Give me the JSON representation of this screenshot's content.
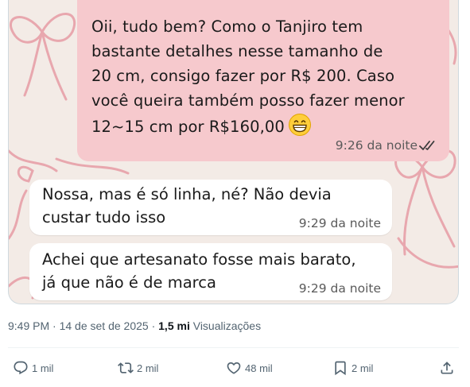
{
  "chat": {
    "outgoing": {
      "text": "Oii, tudo bem? Como o Tanjiro tem\nbastante detalhes nesse tamanho  de\n20 cm, consigo fazer por R$ 200. Caso\nvocê queira também posso fazer menor\n12~15 cm por R$160,00",
      "emoji": "grinning-face",
      "time": "9:26 da noite",
      "status": "read"
    },
    "incoming": [
      {
        "text": "Nossa, mas é só linha, né? Não devia\ncustar tudo isso",
        "time": "9:29 da noite"
      },
      {
        "text": "Achei que artesanato fosse mais barato,\njá que não é de marca",
        "time": "9:29 da noite"
      }
    ],
    "colors": {
      "outgoing_bubble": "#f6c9cd",
      "incoming_bubble": "#ffffff",
      "wallpaper": "#f3ebe6",
      "ribbon": "#e8a7ae"
    }
  },
  "tweet_meta": {
    "timestamp": "9:49 PM · 14 de set de 2025",
    "separator": " · ",
    "views_count": "1,5 mi",
    "views_label": "Visualizações"
  },
  "actions": {
    "reply": {
      "icon": "reply-icon",
      "count": "1 mil"
    },
    "repost": {
      "icon": "repost-icon",
      "count": "2 mil"
    },
    "like": {
      "icon": "heart-icon",
      "count": "48 mil"
    },
    "bookmark": {
      "icon": "bookmark-icon",
      "count": "2 mil"
    },
    "share": {
      "icon": "share-icon"
    }
  }
}
